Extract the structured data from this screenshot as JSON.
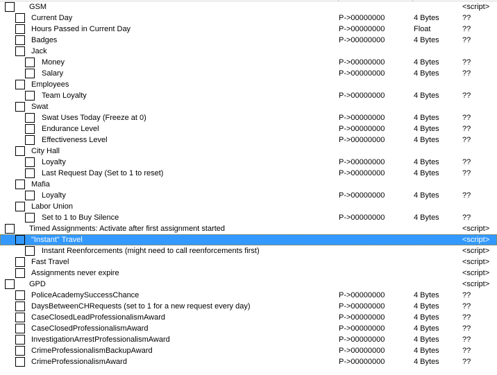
{
  "selection_color": "#3399ff",
  "rows": [
    {
      "desc": "GSM",
      "level": 0,
      "group": true,
      "addr": "",
      "type": "",
      "value": "<script>"
    },
    {
      "desc": "Current Day",
      "level": 1,
      "addr": "P->00000000",
      "type": "4 Bytes",
      "value": "??"
    },
    {
      "desc": "Hours Passed in Current Day",
      "level": 1,
      "addr": "P->00000000",
      "type": "Float",
      "value": "??"
    },
    {
      "desc": "Badges",
      "level": 1,
      "addr": "P->00000000",
      "type": "4 Bytes",
      "value": "??"
    },
    {
      "desc": "Jack",
      "level": 1,
      "addr": "",
      "type": "",
      "value": ""
    },
    {
      "desc": "Money",
      "level": 2,
      "addr": "P->00000000",
      "type": "4 Bytes",
      "value": "??"
    },
    {
      "desc": "Salary",
      "level": 2,
      "addr": "P->00000000",
      "type": "4 Bytes",
      "value": "??"
    },
    {
      "desc": "Employees",
      "level": 1,
      "addr": "",
      "type": "",
      "value": ""
    },
    {
      "desc": "Team Loyalty",
      "level": 2,
      "addr": "P->00000000",
      "type": "4 Bytes",
      "value": "??"
    },
    {
      "desc": "Swat",
      "level": 1,
      "addr": "",
      "type": "",
      "value": ""
    },
    {
      "desc": "Swat Uses Today (Freeze at 0)",
      "level": 2,
      "addr": "P->00000000",
      "type": "4 Bytes",
      "value": "??"
    },
    {
      "desc": "Endurance Level",
      "level": 2,
      "addr": "P->00000000",
      "type": "4 Bytes",
      "value": "??"
    },
    {
      "desc": "Effectiveness Level",
      "level": 2,
      "addr": "P->00000000",
      "type": "4 Bytes",
      "value": "??"
    },
    {
      "desc": "City Hall",
      "level": 1,
      "addr": "",
      "type": "",
      "value": ""
    },
    {
      "desc": "Loyalty",
      "level": 2,
      "addr": "P->00000000",
      "type": "4 Bytes",
      "value": "??"
    },
    {
      "desc": "Last Request Day (Set to 1 to reset)",
      "level": 2,
      "addr": "P->00000000",
      "type": "4 Bytes",
      "value": "??"
    },
    {
      "desc": "Mafia",
      "level": 1,
      "addr": "",
      "type": "",
      "value": ""
    },
    {
      "desc": "Loyalty",
      "level": 2,
      "addr": "P->00000000",
      "type": "4 Bytes",
      "value": "??"
    },
    {
      "desc": "Labor Union",
      "level": 1,
      "addr": "",
      "type": "",
      "value": ""
    },
    {
      "desc": "Set to 1 to Buy Silence",
      "level": 2,
      "addr": "P->00000000",
      "type": "4 Bytes",
      "value": "??"
    },
    {
      "desc": "Timed Assignments: Activate after first assignment started",
      "level": 0,
      "group": true,
      "addr": "",
      "type": "",
      "value": "<script>"
    },
    {
      "desc": "\"Instant\" Travel",
      "level": 1,
      "selected": true,
      "addr": "",
      "type": "",
      "value": "<script>"
    },
    {
      "desc": "Instant Reenforcements (might need to call reenforcements first)",
      "level": 2,
      "addr": "",
      "type": "",
      "value": "<script>"
    },
    {
      "desc": "Fast Travel",
      "level": 1,
      "addr": "",
      "type": "",
      "value": "<script>"
    },
    {
      "desc": "Assignments never expire",
      "level": 1,
      "addr": "",
      "type": "",
      "value": "<script>"
    },
    {
      "desc": "GPD",
      "level": 0,
      "group": true,
      "addr": "",
      "type": "",
      "value": "<script>"
    },
    {
      "desc": "PoliceAcademySuccessChance",
      "level": 1,
      "addr": "P->00000000",
      "type": "4 Bytes",
      "value": "??"
    },
    {
      "desc": "DaysBetweenCHRequests (set to 1 for a new request every day)",
      "level": 1,
      "addr": "P->00000000",
      "type": "4 Bytes",
      "value": "??"
    },
    {
      "desc": "CaseClosedLeadProfessionalismAward",
      "level": 1,
      "addr": "P->00000000",
      "type": "4 Bytes",
      "value": "??"
    },
    {
      "desc": "CaseClosedProfessionalismAward",
      "level": 1,
      "addr": "P->00000000",
      "type": "4 Bytes",
      "value": "??"
    },
    {
      "desc": "InvestigationArrestProfessionalismAward",
      "level": 1,
      "addr": "P->00000000",
      "type": "4 Bytes",
      "value": "??"
    },
    {
      "desc": "CrimeProfessionalismBackupAward",
      "level": 1,
      "addr": "P->00000000",
      "type": "4 Bytes",
      "value": "??"
    },
    {
      "desc": "CrimeProfessionalismAward",
      "level": 1,
      "addr": "P->00000000",
      "type": "4 Bytes",
      "value": "??"
    }
  ]
}
